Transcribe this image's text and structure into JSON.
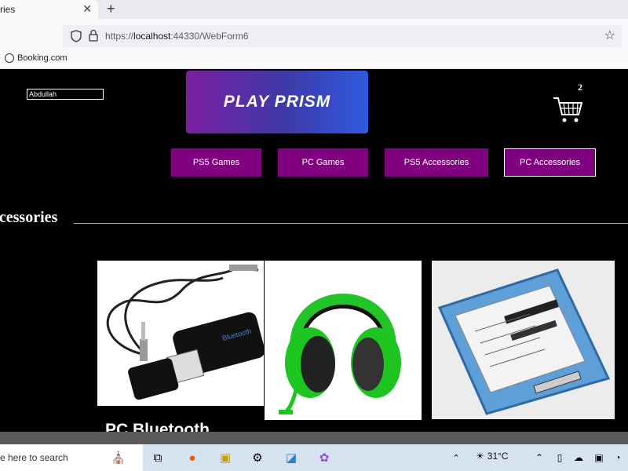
{
  "browser": {
    "tab_title": "ries",
    "url_prefix": "https://",
    "url_host": "localhost",
    "url_rest": ":44330/WebForm6",
    "bookmark": "Booking.com"
  },
  "header": {
    "username": "Abdullah",
    "logo_text": "PLAY PRISM",
    "cart_count": "2"
  },
  "nav": {
    "items": [
      {
        "label": "PS5 Games"
      },
      {
        "label": "PC Games"
      },
      {
        "label": "PS5 Accessories"
      },
      {
        "label": "PC Accessories"
      }
    ]
  },
  "section": {
    "title": "ccessories"
  },
  "products": [
    {
      "title": "PC Bluetooth",
      "image": "bluetooth-adapter-image"
    },
    {
      "image": "green-headset-image"
    },
    {
      "image": "ssd-image"
    }
  ],
  "taskbar": {
    "search_text": "e here to search",
    "temperature": "31°C"
  },
  "colors": {
    "nav_purple": "#800080",
    "logo_gradient_start": "#7b1fa2",
    "logo_gradient_end": "#2f5ae0"
  }
}
